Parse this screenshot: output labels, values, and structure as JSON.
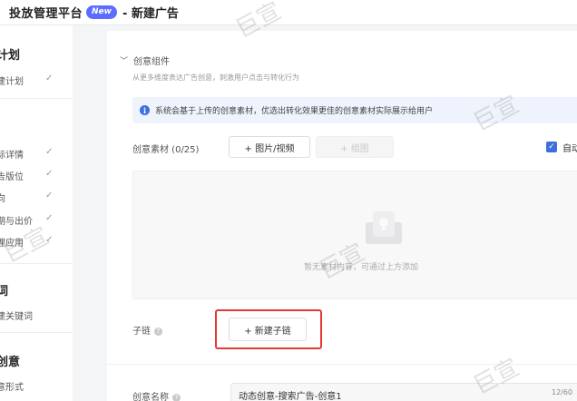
{
  "header": {
    "app_title": "投放管理平台",
    "new_badge": "New",
    "page_title": "- 新建广告"
  },
  "sidebar": {
    "sections": [
      {
        "heading": "计划",
        "items": [
          {
            "label": "建计划",
            "checked": true
          }
        ]
      },
      {
        "heading": "",
        "items": [
          {
            "label": "标详情",
            "checked": true
          },
          {
            "label": "告版位",
            "checked": true
          },
          {
            "label": "向",
            "checked": true
          },
          {
            "label": "期与出价",
            "checked": true
          },
          {
            "label": "理应用",
            "checked": true
          }
        ]
      },
      {
        "heading": "词",
        "items": [
          {
            "label": "建关键词",
            "checked": false
          }
        ]
      },
      {
        "heading": "创意",
        "items": [
          {
            "label": "意形式",
            "checked": false
          }
        ]
      }
    ],
    "check_glyph": "✓"
  },
  "creative": {
    "section_title": "创意组件",
    "section_desc": "从更多维度表达广告创意，刺激用户点击与转化行为",
    "info_text": "系统会基于上传的创意素材，优选出转化效果更佳的创意素材实际展示给用户",
    "material_label": "创意素材 (0/25)",
    "add_media_button": "+ 图片/视频",
    "group_button": "+ 组图",
    "auto_label": "自动",
    "auto_checked": true,
    "empty_text": "暂无素材内容，可通过上方添加",
    "sublink_label": "子链",
    "new_sublink_button": "+ 新建子链",
    "name_label": "创意名称",
    "name_value": "动态创意-搜索广告-创意1",
    "name_count": "12/60"
  },
  "watermark": "巨宣",
  "colors": {
    "accent": "#3b6fe0",
    "badge": "#5b6cff",
    "highlight": "#e53935"
  }
}
